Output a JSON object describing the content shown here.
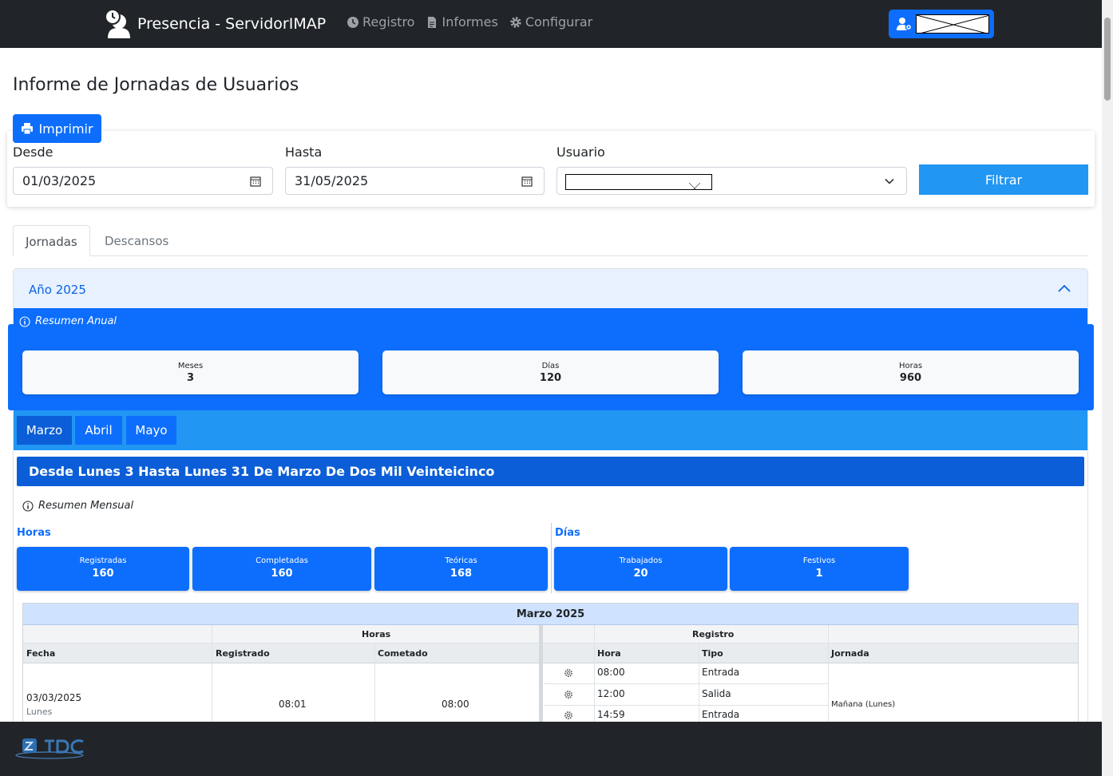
{
  "navbar": {
    "brand": "Presencia - ServidorIMAP",
    "links": [
      "Registro",
      "Informes",
      "Configurar"
    ]
  },
  "page": {
    "title": "Informe de Jornadas de Usuarios",
    "print_label": "Imprimir"
  },
  "filters": {
    "desde_label": "Desde",
    "desde_value": "01/03/2025",
    "hasta_label": "Hasta",
    "hasta_value": "31/05/2025",
    "usuario_label": "Usuario",
    "filter_label": "Filtrar"
  },
  "tabs": [
    "Jornadas",
    "Descansos"
  ],
  "accordion": {
    "header": "Año 2025",
    "annual_title": "Resumen Anual",
    "annual_stats": [
      {
        "label": "Meses",
        "value": "3"
      },
      {
        "label": "Días",
        "value": "120"
      },
      {
        "label": "Horas",
        "value": "960"
      }
    ],
    "months": [
      "Marzo",
      "Abril",
      "Mayo"
    ],
    "range_title": "Desde Lunes 3 Hasta Lunes 31 De Marzo De Dos Mil Veinteicinco",
    "monthly_title": "Resumen Mensual",
    "horas_label": "Horas",
    "dias_label": "Días",
    "horas_stats": [
      {
        "label": "Registradas",
        "value": "160"
      },
      {
        "label": "Completadas",
        "value": "160"
      },
      {
        "label": "Teóricas",
        "value": "168"
      }
    ],
    "dias_stats": [
      {
        "label": "Trabajados",
        "value": "20"
      },
      {
        "label": "Festivos",
        "value": "1"
      }
    ]
  },
  "table": {
    "caption": "Marzo 2025",
    "group_horas": "Horas",
    "group_registro": "Registro",
    "headers": {
      "fecha": "Fecha",
      "registrado": "Registrado",
      "completado": "Cometado",
      "hora": "Hora",
      "tipo": "Tipo",
      "jornada": "Jornada"
    },
    "row": {
      "fecha": "03/03/2025",
      "dia": "Lunes",
      "registrado": "08:01",
      "completado": "08:00",
      "jornada": "Mañana (Lunes)",
      "registros": [
        {
          "hora": "08:00",
          "tipo": "Entrada"
        },
        {
          "hora": "12:00",
          "tipo": "Salida"
        },
        {
          "hora": "14:59",
          "tipo": "Entrada"
        }
      ]
    }
  }
}
